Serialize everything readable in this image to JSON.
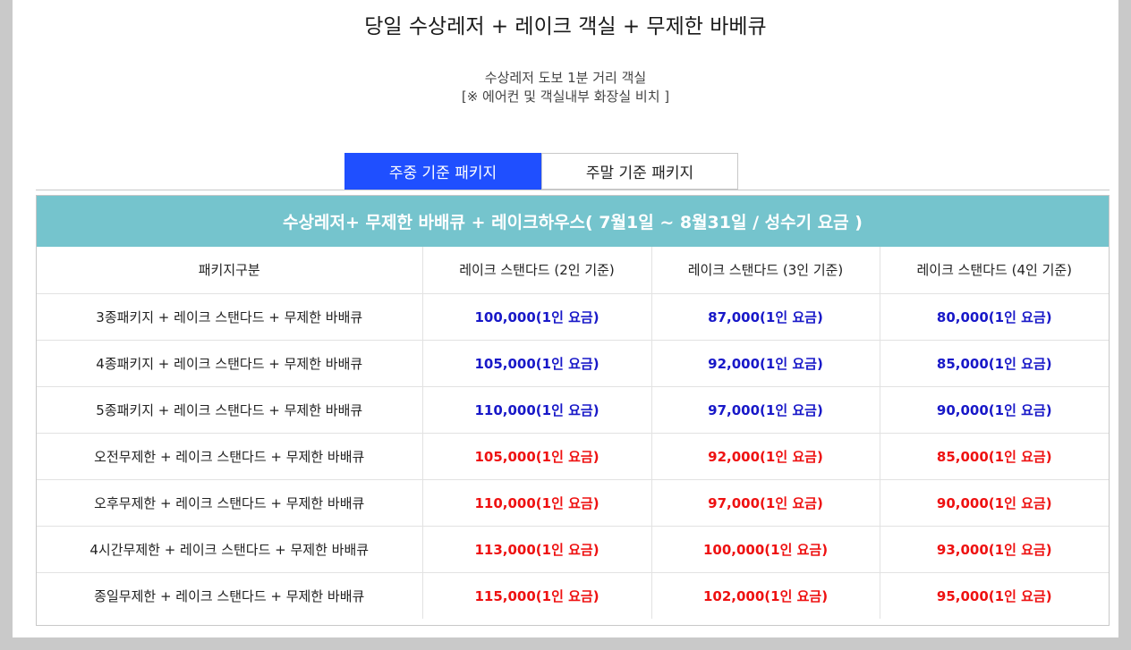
{
  "header": {
    "title": "당일 수상레저 + 레이크 객실 + 무제한 바베큐",
    "subtitle_line1": "수상레저 도보 1분 거리 객실",
    "subtitle_line2": "[※ 에어컨 및 객실내부 화장실 비치 ]"
  },
  "tabs": [
    {
      "label": "주중 기준 패키지",
      "active": true
    },
    {
      "label": "주말 기준 패키지",
      "active": false
    }
  ],
  "colors": {
    "tab_active": "#1f4fff",
    "banner": "#75c4cd",
    "price_blue": "#1818c8",
    "price_red": "#ee1111"
  },
  "table": {
    "banner": "수상레저+ 무제한 바배큐 + 레이크하우스( 7월1일 ~ 8월31일 / 성수기 요금 )",
    "columns": [
      "패키지구분",
      "레이크 스탠다드 (2인 기준)",
      "레이크 스탠다드 (3인 기준)",
      "레이크 스탠다드 (4인 기준)"
    ],
    "rows": [
      {
        "name": "3종패키지 + 레이크 스탠다드 + 무제한 바배큐",
        "color": "blue",
        "prices": [
          "100,000(1인 요금)",
          "87,000(1인 요금)",
          "80,000(1인 요금)"
        ]
      },
      {
        "name": "4종패키지 + 레이크 스탠다드 + 무제한 바배큐",
        "color": "blue",
        "prices": [
          "105,000(1인 요금)",
          "92,000(1인 요금)",
          "85,000(1인 요금)"
        ]
      },
      {
        "name": "5종패키지 + 레이크 스탠다드 + 무제한 바배큐",
        "color": "blue",
        "prices": [
          "110,000(1인 요금)",
          "97,000(1인 요금)",
          "90,000(1인 요금)"
        ]
      },
      {
        "name": "오전무제한 + 레이크 스탠다드 + 무제한 바배큐",
        "color": "red",
        "prices": [
          "105,000(1인 요금)",
          "92,000(1인 요금)",
          "85,000(1인 요금)"
        ]
      },
      {
        "name": "오후무제한 + 레이크 스탠다드 + 무제한 바배큐",
        "color": "red",
        "prices": [
          "110,000(1인 요금)",
          "97,000(1인 요금)",
          "90,000(1인 요금)"
        ]
      },
      {
        "name": "4시간무제한 + 레이크 스탠다드 + 무제한 바배큐",
        "color": "red",
        "prices": [
          "113,000(1인 요금)",
          "100,000(1인 요금)",
          "93,000(1인 요금)"
        ]
      },
      {
        "name": "종일무제한 + 레이크 스탠다드 + 무제한 바배큐",
        "color": "red",
        "prices": [
          "115,000(1인 요금)",
          "102,000(1인 요금)",
          "95,000(1인 요금)"
        ]
      }
    ]
  }
}
